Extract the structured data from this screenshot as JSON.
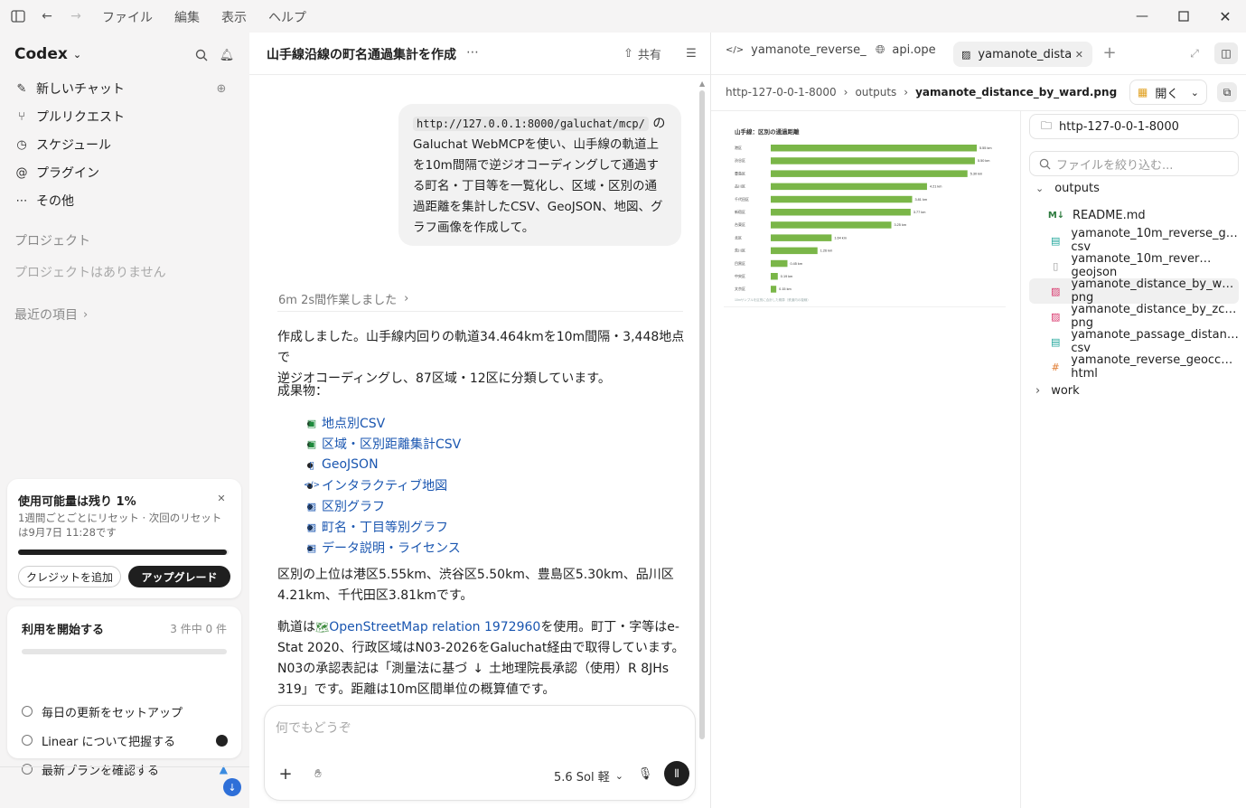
{
  "menu": {
    "items": [
      "ファイル",
      "編集",
      "表示",
      "ヘルプ"
    ]
  },
  "sidebar": {
    "app_name": "Codex",
    "nav": [
      {
        "label": "新しいチャット",
        "icon": "edit-icon"
      },
      {
        "label": "プルリクエスト",
        "icon": "pull-request-icon"
      },
      {
        "label": "スケジュール",
        "icon": "clock-icon"
      },
      {
        "label": "プラグイン",
        "icon": "at-icon"
      },
      {
        "label": "その他",
        "icon": "more-icon"
      }
    ],
    "projects_heading": "プロジェクト",
    "projects_empty": "プロジェクトはありません",
    "recent": "最近の項目",
    "usage_card": {
      "title": "使用可能量は残り 1%",
      "desc": "1週間ごとごとにリセット · 次回のリセットは9月7日 11:28です",
      "progress": 0.99,
      "add_credit": "クレジットを追加",
      "upgrade": "アップグレード"
    },
    "start_card": {
      "title": "利用を開始する",
      "count": "3 件中 0 件",
      "progress": 0,
      "tasks": [
        "毎日の更新をセットアップ",
        "Linear について把握する",
        "最新プランを確認する"
      ]
    }
  },
  "chat": {
    "title": "山手線沿線の町名通過集計を作成",
    "share": "共有",
    "user_message": {
      "code": "http://127.0.0.1:8000/galuchat/mcp/",
      "line1_suffix": " の",
      "lines": [
        "Galuchat WebMCPを使い、山手線の軌道上",
        "を10m間隔で逆ジオコーディングして通過す",
        "る町名・丁目等を一覧化し、区域・区別の通",
        "過距離を集計したCSV、GeoJSON、地図、グ",
        "ラフ画像を作成して。"
      ]
    },
    "worked": "6m 2s間作業しました",
    "p1": [
      "作成しました。山手線内回りの軌道34.464kmを10m間隔・3,448地点で",
      "逆ジオコーディングし、87区域・12区に分類しています。"
    ],
    "deliverables_heading": "成果物：",
    "deliverables": [
      {
        "label": "地点別CSV",
        "icon": "spreadsheet-icon"
      },
      {
        "label": "区域・区別距離集計CSV",
        "icon": "spreadsheet-icon"
      },
      {
        "label": "GeoJSON",
        "icon": "file-icon"
      },
      {
        "label": "インタラクティブ地図",
        "icon": "code-icon"
      },
      {
        "label": "区別グラフ",
        "icon": "image-icon"
      },
      {
        "label": "町名・丁目等別グラフ",
        "icon": "image-icon"
      },
      {
        "label": "データ説明・ライセンス",
        "icon": "document-icon"
      }
    ],
    "p2": [
      "区別の上位は港区5.55km、渋谷区5.50km、豊島区5.30km、品川区",
      "4.21km、千代田区3.81kmです。"
    ],
    "p3_a": "軌道は",
    "p3_link": "OpenStreetMap relation 1972960",
    "p3_b": "を使用。町丁・字等はe-",
    "p3_lines": [
      "Stat 2020、行政区域はN03-2026をGaluchat経由で取得しています。",
      "N03の承認表記は「測量法に基づ",
      ""
    ],
    "p3_line3_b": "土地理院長承認（使用）R 8JHs",
    "p3_line4": "319」です。距離は10m区間単位の概算値です。",
    "composer_placeholder": "何でもどうぞ",
    "model": "5.6 Sol 軽"
  },
  "tabs": [
    {
      "label": "yamanote_reverse_",
      "icon": "code-icon"
    },
    {
      "label": "api.ope",
      "icon": "globe-icon"
    },
    {
      "label": "yamanote_dista",
      "icon": "image-icon"
    }
  ],
  "breadcrumb": [
    "http-127-0-0-1-8000",
    "outputs",
    "yamanote_distance_by_ward.png"
  ],
  "open_button": "開く",
  "filetree": {
    "root": "http-127-0-0-1-8000",
    "filter_placeholder": "ファイルを絞り込む...",
    "folder_outputs": "outputs",
    "files": [
      {
        "label": "README.md",
        "icon": "markdown-icon",
        "color": "#2d7a3e"
      },
      {
        "label": "yamanote_10m_reverse_g…csv",
        "icon": "spreadsheet-icon",
        "color": "#1fa59a"
      },
      {
        "label": "yamanote_10m_rever…geojson",
        "icon": "file-icon",
        "color": "#9a9a9a"
      },
      {
        "label": "yamanote_distance_by_w…png",
        "icon": "image-icon",
        "color": "#d8356b"
      },
      {
        "label": "yamanote_distance_by_zc…png",
        "icon": "image-icon",
        "color": "#d8356b"
      },
      {
        "label": "yamanote_passage_distan…csv",
        "icon": "spreadsheet-icon",
        "color": "#1fa59a"
      },
      {
        "label": "yamanote_reverse_geocc…html",
        "icon": "hash-icon",
        "color": "#e07a2f"
      }
    ],
    "folder_work": "work"
  },
  "chart_data": {
    "type": "bar",
    "title": "山手線：区別の通過距離",
    "categories": [
      "港区",
      "渋谷区",
      "豊島区",
      "品川区",
      "千代田区",
      "新宿区",
      "台東区",
      "北区",
      "荒川区",
      "目黒区",
      "中央区",
      "文京区"
    ],
    "values": [
      5.55,
      5.5,
      5.3,
      4.21,
      3.81,
      3.77,
      3.25,
      1.64,
      1.26,
      0.45,
      0.19,
      0.15
    ],
    "value_labels": [
      "5.55 km",
      "5.50 km",
      "5.30 km",
      "4.21 km",
      "3.81 km",
      "3.77 km",
      "3.25 km",
      "1.64 km",
      "1.26 km",
      "0.45 km",
      "0.19 km",
      "0.15 km"
    ],
    "footnote": "10mサンプルを区別に合計した概算（鉄道内の複線）",
    "color": "#7ab648"
  }
}
